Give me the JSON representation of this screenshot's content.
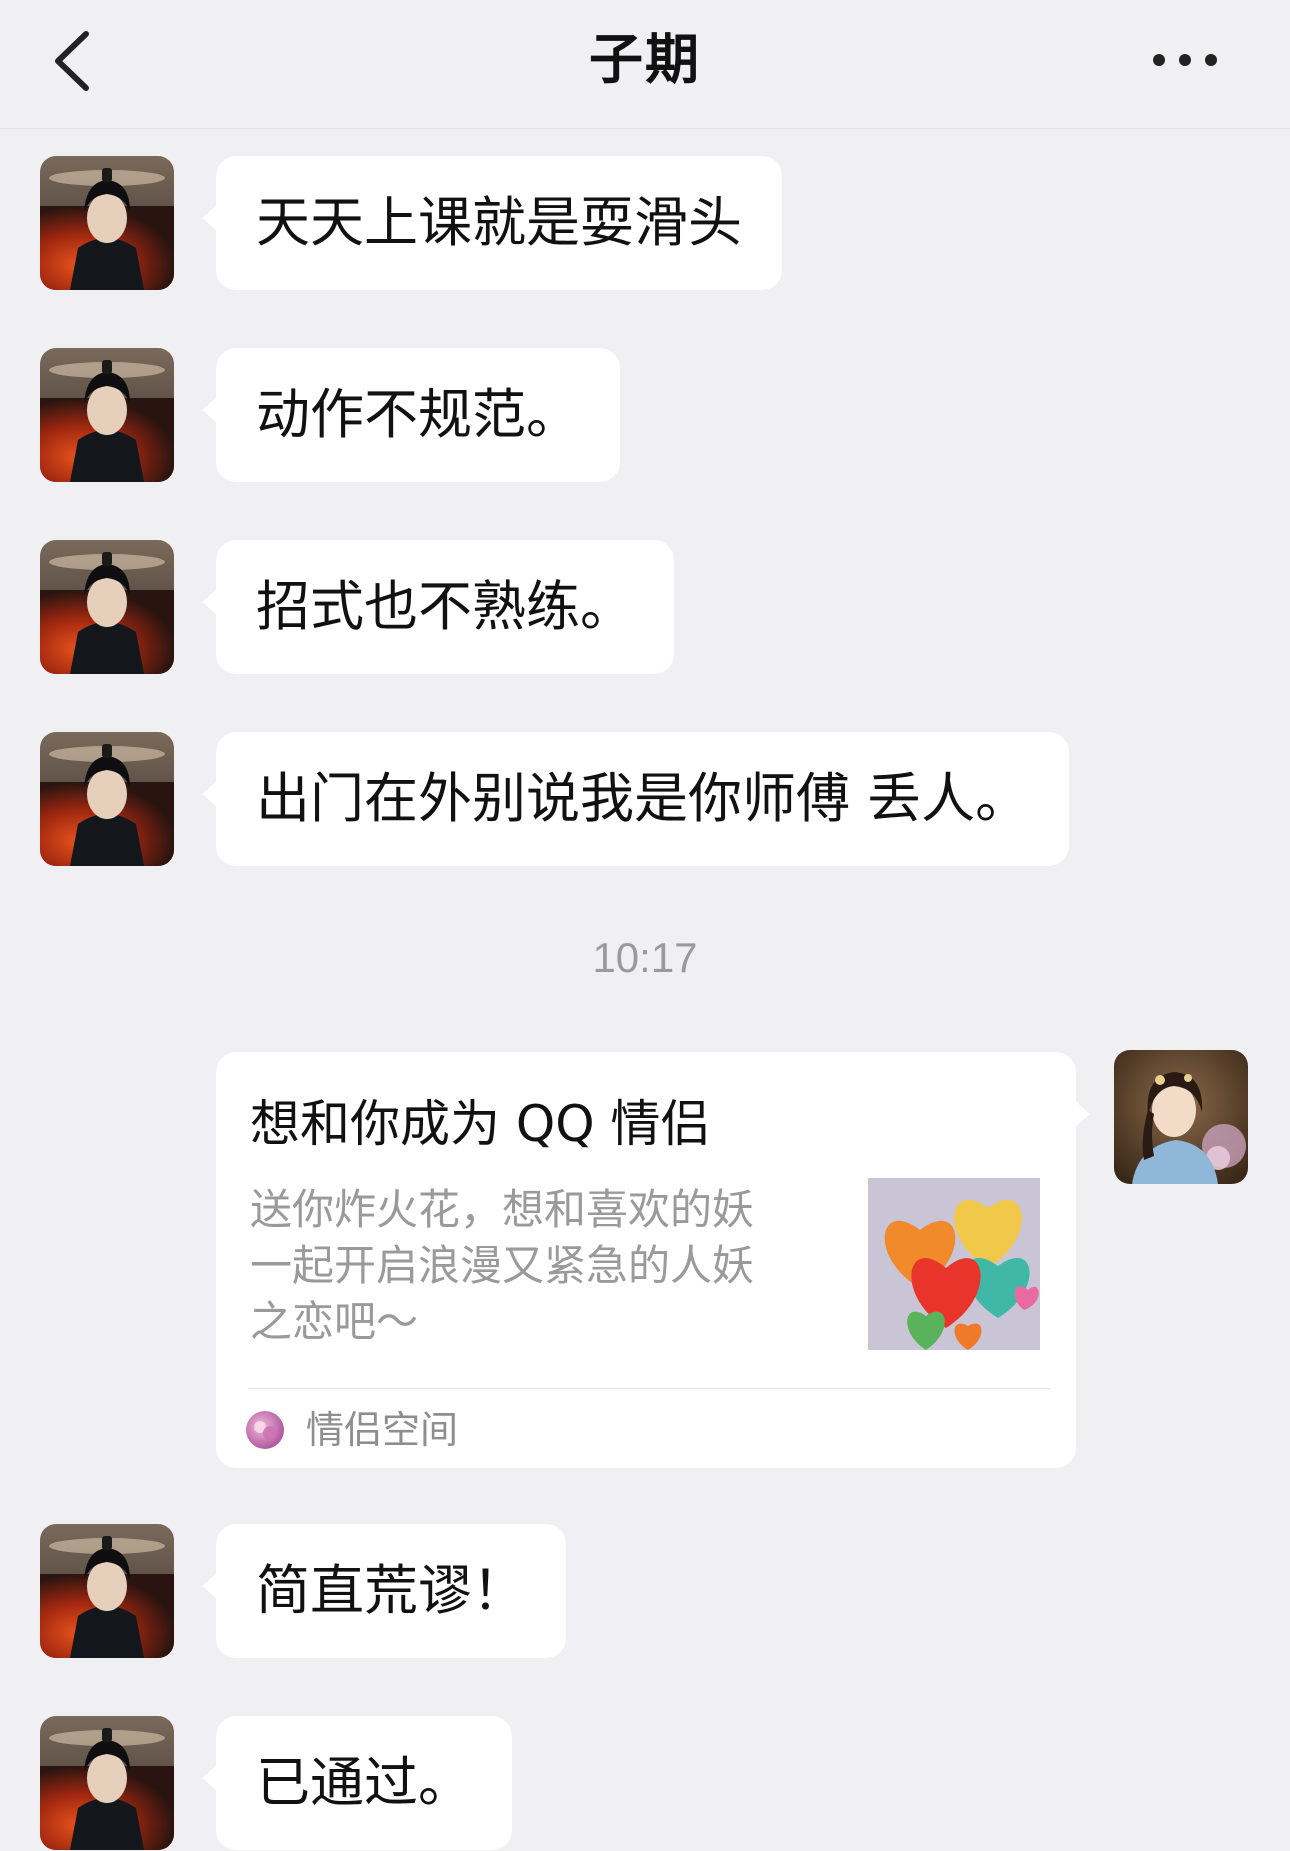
{
  "header": {
    "title": "子期",
    "back_icon": "chevron-left-icon",
    "more_icon": "more-horizontal-icon"
  },
  "messages_before": [
    {
      "sender": "contact",
      "text": "天天上课就是耍滑头"
    },
    {
      "sender": "contact",
      "text": "动作不规范。"
    },
    {
      "sender": "contact",
      "text": "招式也不熟练。"
    },
    {
      "sender": "contact",
      "text": "出门在外别说我是你师傅 丢人。"
    }
  ],
  "timestamp": "10:17",
  "card": {
    "sender": "self",
    "title": "想和你成为 QQ 情侣",
    "description": "送你炸火花，想和喜欢的妖一起开启浪漫又紧急的人妖之恋吧～",
    "image_icon": "hearts-image",
    "source_label": "情侣空间",
    "source_icon": "couple-space-app-icon"
  },
  "messages_after": [
    {
      "sender": "contact",
      "text": "简直荒谬！"
    },
    {
      "sender": "contact",
      "text": "已通过。"
    }
  ],
  "colors": {
    "background": "#f0f0f2",
    "bubble": "#ffffff",
    "timestamp_text": "#9a9a9a",
    "card_desc_text": "#9a9a9a"
  }
}
